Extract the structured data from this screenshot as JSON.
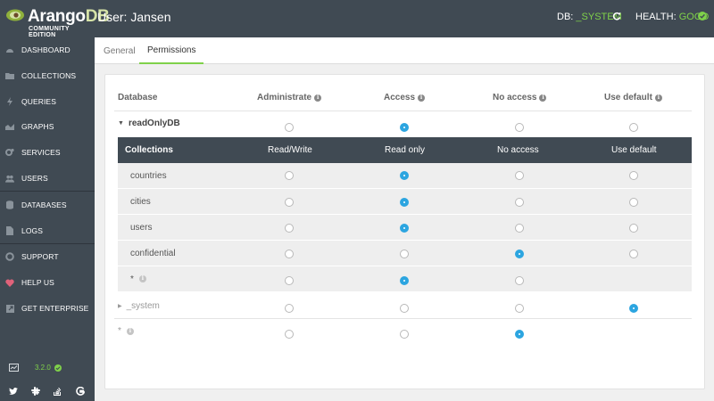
{
  "app": {
    "brand_main": "Arango",
    "brand_db": "DB",
    "brand_edition": "COMMUNITY EDITION",
    "user_label": "User: Jansen",
    "db_prefix": "DB: ",
    "db_value": "_SYSTEM",
    "health_prefix": "HEALTH: ",
    "health_value": "GOOD",
    "accent": "#7fd14a",
    "radio_on": "#2ca5e0",
    "sidebar_bg": "#404a53"
  },
  "sidebar": {
    "items": [
      {
        "label": "DASHBOARD",
        "icon": "dashboard-icon"
      },
      {
        "label": "COLLECTIONS",
        "icon": "folder-icon"
      },
      {
        "label": "QUERIES",
        "icon": "bolt-icon"
      },
      {
        "label": "GRAPHS",
        "icon": "area-chart-icon"
      },
      {
        "label": "SERVICES",
        "icon": "cogs-icon"
      },
      {
        "label": "USERS",
        "icon": "users-icon"
      },
      {
        "label": "DATABASES",
        "icon": "database-icon"
      },
      {
        "label": "LOGS",
        "icon": "file-icon"
      },
      {
        "label": "SUPPORT",
        "icon": "lifebuoy-icon"
      },
      {
        "label": "HELP US",
        "icon": "heart-icon"
      },
      {
        "label": "GET ENTERPRISE",
        "icon": "external-link-icon"
      }
    ],
    "version": "3.2.0",
    "social": [
      "twitter-icon",
      "slack-icon",
      "stackoverflow-icon",
      "google-icon"
    ]
  },
  "tabs": [
    {
      "label": "General",
      "active": false
    },
    {
      "label": "Permissions",
      "active": true
    }
  ],
  "permissions": {
    "header": {
      "database": "Database",
      "administrate": "Administrate",
      "access": "Access",
      "no_access": "No access",
      "use_default": "Use default"
    },
    "databases": [
      {
        "name": "readOnlyDB",
        "expanded": true,
        "selected": "access"
      },
      {
        "name": "_system",
        "expanded": false,
        "selected": "use_default"
      },
      {
        "name": "*",
        "expanded": false,
        "selected": "no_access"
      }
    ],
    "collections_header": {
      "collections": "Collections",
      "read_write": "Read/Write",
      "read_only": "Read only",
      "no_access": "No access",
      "use_default": "Use default"
    },
    "collections": [
      {
        "name": "countries",
        "selected": "read_only"
      },
      {
        "name": "cities",
        "selected": "read_only"
      },
      {
        "name": "users",
        "selected": "read_only"
      },
      {
        "name": "confidential",
        "selected": "no_access"
      },
      {
        "name": "*",
        "selected": "read_only"
      }
    ]
  }
}
